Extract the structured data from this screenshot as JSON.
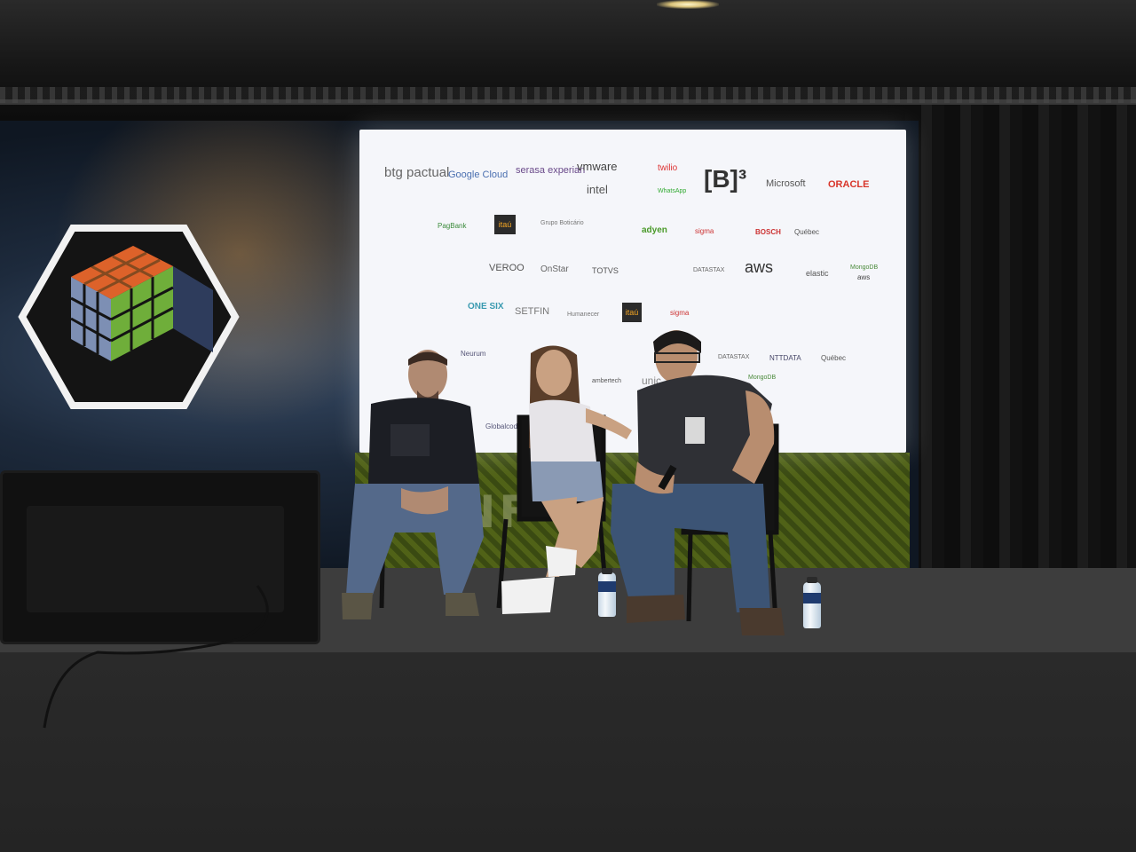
{
  "scene": {
    "description_tag": "conference-panel-stage"
  },
  "screen_logos": {
    "row1": [
      "btg pactual",
      "Google Cloud",
      "serasa experian",
      "vmware",
      "intel",
      "twilio",
      "WhatsApp",
      "[B]³",
      "Microsoft",
      "ORACLE"
    ],
    "row2": [
      "PagBank",
      "itaú",
      "Grupo Boticário",
      "adyen",
      "sigma",
      "BOSCH",
      "Québec"
    ],
    "row3": [
      "VEROO",
      "OnStar",
      "TOTVS",
      "DATASTAX",
      "aws",
      "elastic",
      "MongoDB",
      "aws"
    ],
    "row4": [
      "ONE SIX",
      "SETFIN",
      "Humanecer",
      "itaú",
      "sigma"
    ],
    "row5": [
      "Neurum",
      "DATASTAX",
      "NTTDATA",
      "Québec",
      "MongoDB",
      "ambertech",
      "unic",
      "Globalcode"
    ]
  },
  "backdrop_text": "THE ... CONF",
  "backdrop_text_visible": "ONF",
  "colors": {
    "screen_bg": "#f5f6fa",
    "backdrop_blue": "#1d2a3c",
    "backdrop_green": "#506217",
    "stage": "#2b2b2b"
  }
}
